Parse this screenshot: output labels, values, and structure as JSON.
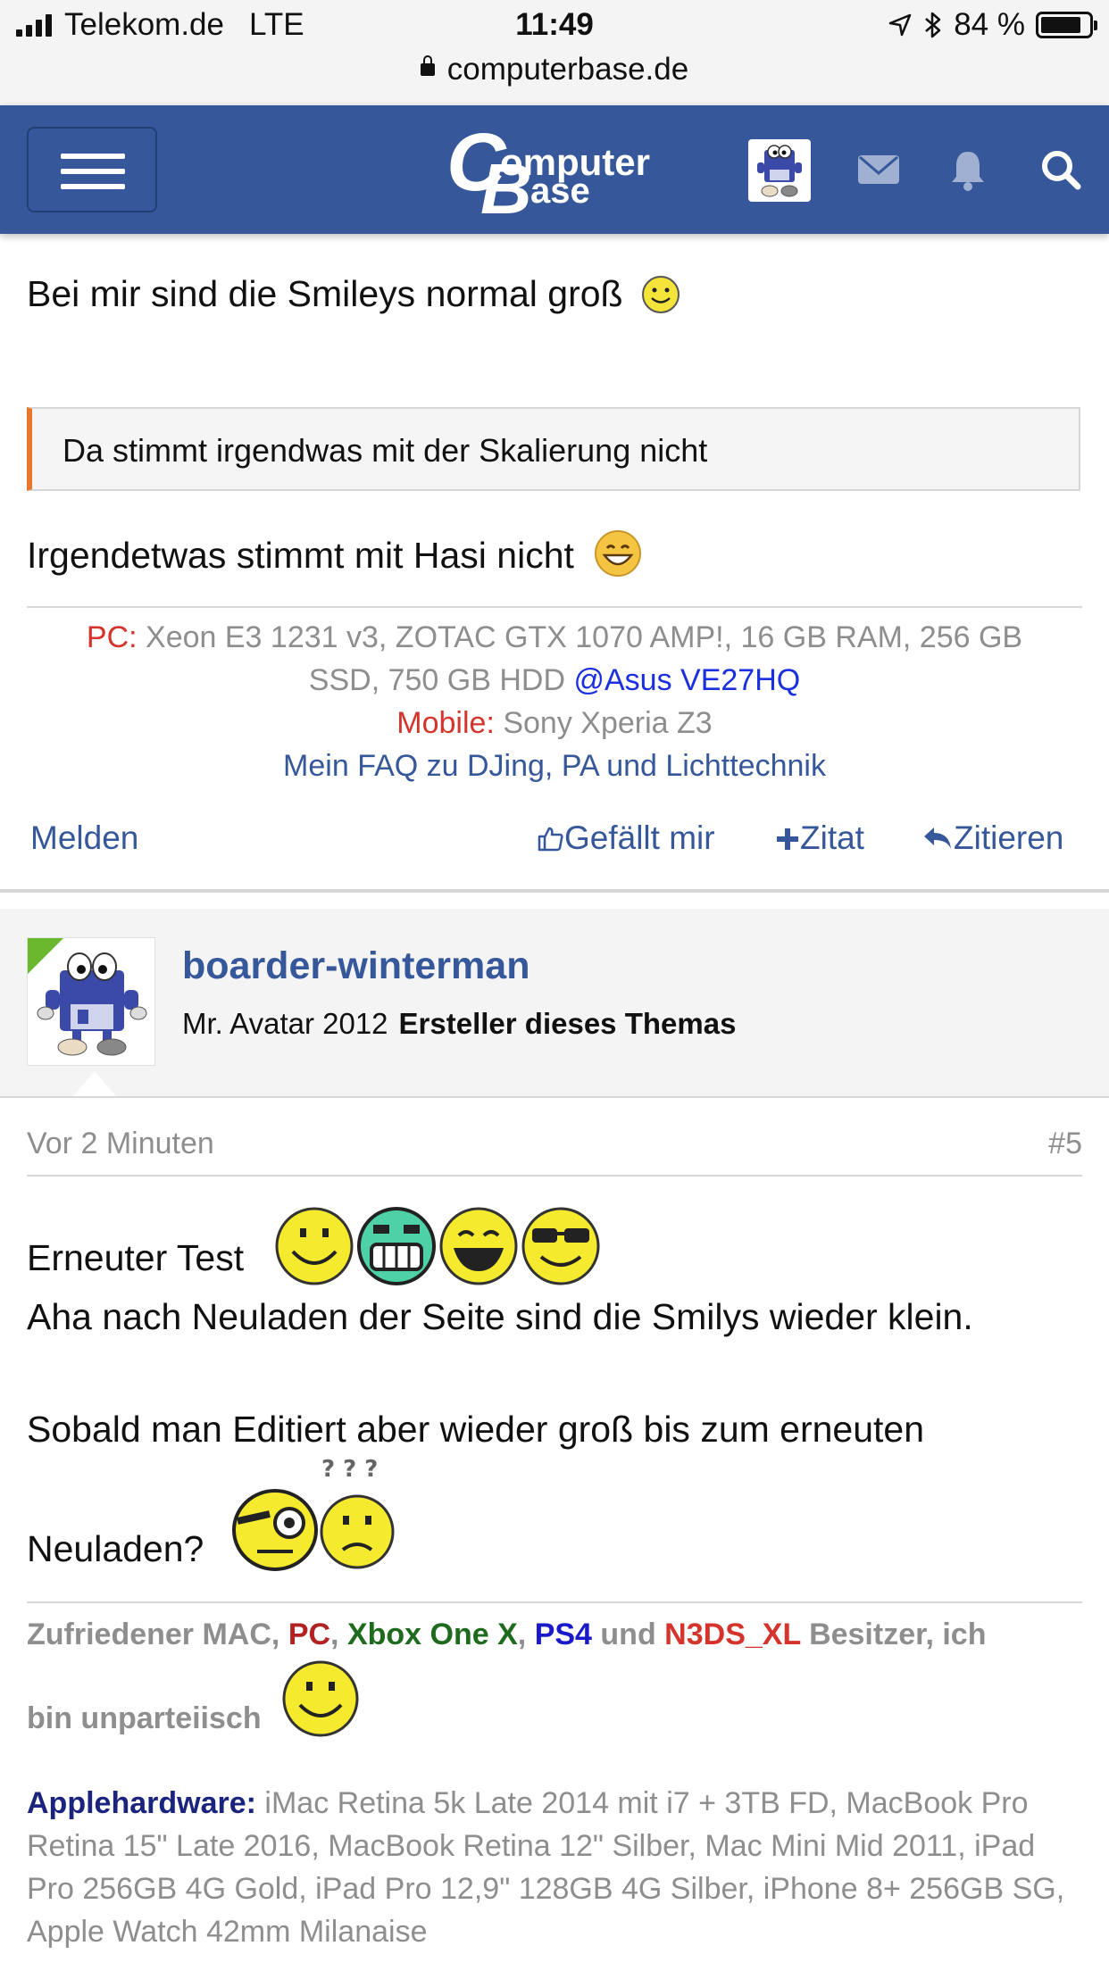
{
  "status_bar": {
    "carrier": "Telekom.de",
    "network": "LTE",
    "time": "11:49",
    "battery": "84 %",
    "battery_level": 0.84,
    "url": "computerbase.de"
  },
  "navbar": {
    "logo_text_1": "omputer",
    "logo_text_2": "ase",
    "logo_c": "C",
    "logo_b": "B",
    "accent": "#36579a"
  },
  "post_prev": {
    "line1": "Bei mir sind die Smileys normal groß",
    "quote": "Da stimmt irgendwas mit der Skalierung nicht",
    "line2": "Irgendetwas stimmt mit Hasi nicht",
    "signature": {
      "pc_label": "PC:",
      "pc_text_1": "Xeon E3 1231 v3, ZOTAC GTX 1070 AMP!, 16 GB RAM, 256 GB",
      "pc_text_2": "SSD, 750 GB HDD",
      "monitor_link": "@Asus VE27HQ",
      "mobile_label": "Mobile:",
      "mobile_text": "Sony Xperia Z3",
      "faq_link": "Mein FAQ zu DJing, PA und Lichttechnik"
    },
    "actions": {
      "report": "Melden",
      "like": "Gefällt mir",
      "quote_add": "Zitat",
      "reply": "Zitieren"
    }
  },
  "post": {
    "username": "boarder-winterman",
    "user_title": "Mr. Avatar 2012",
    "creator_badge": "Ersteller dieses Themas",
    "time": "Vor 2 Minuten",
    "number": "#5",
    "body_1": "Erneuter Test",
    "body_2": "Aha nach Neuladen der Seite sind die Smilys wieder klein.",
    "body_3": "Sobald man Editiert aber wieder groß bis zum erneuten",
    "body_4": "Neuladen?",
    "signature": {
      "s1": "Zufriedener MAC,",
      "s2": "PC",
      "s3": ",",
      "s4": "Xbox One X",
      "s5": ",",
      "s6": "PS4",
      "s7": "und",
      "s8": "N3DS_XL",
      "s9": "Besitzer, ich",
      "s10": "bin unparteiisch",
      "apple_label": "Applehardware:",
      "apple_text": "iMac Retina 5k Late 2014 mit i7 + 3TB FD, MacBook Pro Retina 15\" Late 2016, MacBook Retina 12\" Silber, Mac Mini Mid 2011, iPad Pro 256GB 4G Gold, iPad Pro 12,9\" 128GB 4G Silber, iPhone 8+ 256GB SG, Apple Watch 42mm Milanaise"
    }
  }
}
